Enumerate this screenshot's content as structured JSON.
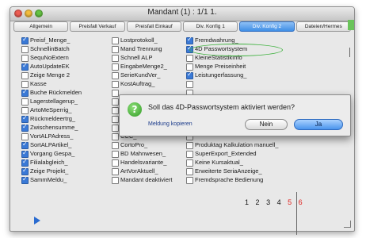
{
  "window": {
    "title": "Mandant (1) : 1/1 1."
  },
  "tabs": [
    "Allgemein",
    "Preisfall Verkauf",
    "Preisfall Einkauf",
    "Div. Konfig 1",
    "Div. Konfig 2",
    "Dateien/Hermes"
  ],
  "active_tab_index": 4,
  "columns": [
    [
      {
        "label": "Preisf_Menge_",
        "checked": true
      },
      {
        "label": "SchnellinBatch",
        "checked": false
      },
      {
        "label": "SequNoExtern",
        "checked": false
      },
      {
        "label": "AutoUpdateEK",
        "checked": true
      },
      {
        "label": "Zeige Menge 2",
        "checked": false
      },
      {
        "label": "Kasse",
        "checked": false
      },
      {
        "label": "Buche Rückmelden",
        "checked": true
      },
      {
        "label": "Lagerstellagerup_",
        "checked": false
      },
      {
        "label": "ArtoMeSperrig_",
        "checked": false
      },
      {
        "label": "Rückmeldeertrg_",
        "checked": true
      },
      {
        "label": "Zwischensumme_",
        "checked": true
      },
      {
        "label": "VortALPAdress_",
        "checked": false
      },
      {
        "label": "SortALPArtikel_",
        "checked": true
      },
      {
        "label": "Vorgang Gespa_",
        "checked": true
      },
      {
        "label": "Filialabgleich_",
        "checked": true
      },
      {
        "label": "Zeige Projekt_",
        "checked": true
      },
      {
        "label": "SammMeldu_",
        "checked": true
      }
    ],
    [
      {
        "label": "Lostprotokoll_",
        "checked": false
      },
      {
        "label": "Mand Trennung",
        "checked": false
      },
      {
        "label": "Schnell ALP",
        "checked": false
      },
      {
        "label": "EingabeMenge2_",
        "checked": false
      },
      {
        "label": "SerieKundVer_",
        "checked": false
      },
      {
        "label": "KostAuftrag_",
        "checked": false
      },
      {
        "label": "",
        "checked": false
      },
      {
        "label": "",
        "checked": false
      },
      {
        "label": "",
        "checked": false
      },
      {
        "label": "",
        "checked": false
      },
      {
        "label": "",
        "checked": false
      },
      {
        "label": "CCC_",
        "checked": false
      },
      {
        "label": "CortoPro_",
        "checked": false
      },
      {
        "label": "BD Mahnwesen_",
        "checked": false
      },
      {
        "label": "Handelsvariante_",
        "checked": false
      },
      {
        "label": "ArtVorAktuell_",
        "checked": false
      },
      {
        "label": "Mandant deaktiviert",
        "checked": false
      }
    ],
    [
      {
        "label": "Fremdwahrung_",
        "checked": true
      },
      {
        "label": "4D Passwortsystem",
        "checked": true
      },
      {
        "label": "KleineStatistikInfo",
        "checked": false
      },
      {
        "label": "Menge Preiseinheit",
        "checked": false
      },
      {
        "label": "Leistungerfassung_",
        "checked": true
      },
      {
        "label": "",
        "checked": false
      },
      {
        "label": "",
        "checked": false
      },
      {
        "label": "",
        "checked": false
      },
      {
        "label": "",
        "checked": false
      },
      {
        "label": "",
        "checked": false
      },
      {
        "label": "",
        "checked": false
      },
      {
        "label": "",
        "checked": false
      },
      {
        "label": "Produktag Kalkulation manuell_",
        "checked": false
      },
      {
        "label": "SuperExport_Extended",
        "checked": false
      },
      {
        "label": "Keine Kursaktual_",
        "checked": false
      },
      {
        "label": "Erweiterte SeriaAnzeige_",
        "checked": false
      },
      {
        "label": "Fremdsprache Bedienung",
        "checked": false
      }
    ]
  ],
  "pagination": [
    "1",
    "2",
    "3",
    "4",
    "5",
    "6"
  ],
  "pagination_active": [
    "5",
    "6"
  ],
  "dialog": {
    "question": "Soll das 4D-Passwortsystem aktiviert werden?",
    "copy_link": "Meldung kopieren",
    "no_label": "Nein",
    "yes_label": "Ja",
    "icon": "question-icon"
  },
  "colors": {
    "accent_blue": "#3f8fe6",
    "highlight_green": "#3db13d",
    "page_red": "#e0201c",
    "icon_green": "#2f9a24"
  }
}
